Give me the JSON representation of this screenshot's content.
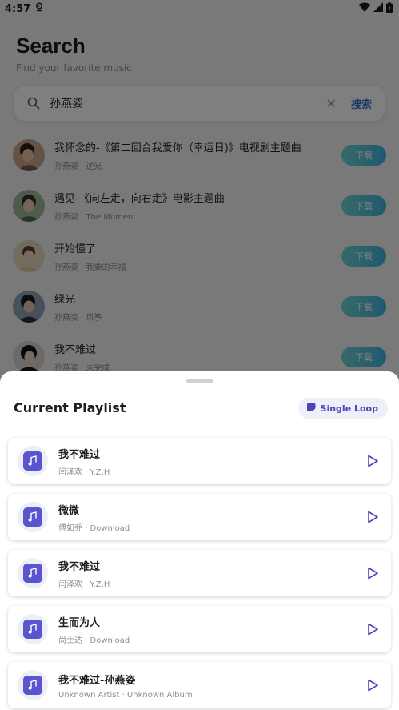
{
  "status": {
    "time": "4:57"
  },
  "page": {
    "title": "Search",
    "subtitle": "Find your favorite music"
  },
  "search": {
    "value": "孙燕姿",
    "search_label": "搜索"
  },
  "results": [
    {
      "title": "我怀念的-《第二回合我爱你（幸运日)》电视剧主题曲",
      "subtitle": "孙燕姿 · 逆光",
      "download_label": "下载"
    },
    {
      "title": "遇见-《向左走，向右走》电影主题曲",
      "subtitle": "孙燕姿 · The Moment",
      "download_label": "下载"
    },
    {
      "title": "开始懂了",
      "subtitle": "孙燕姿 · 我要的幸福",
      "download_label": "下载"
    },
    {
      "title": "绿光",
      "subtitle": "孙燕姿 · 风筝",
      "download_label": "下载"
    },
    {
      "title": "我不难过",
      "subtitle": "孙燕姿 · 未完成",
      "download_label": "下载"
    }
  ],
  "sheet": {
    "title": "Current Playlist",
    "loop_label": "Single Loop",
    "tracks": [
      {
        "title": "我不难过",
        "subtitle": "闫泽欢 · Y.Z.H"
      },
      {
        "title": "微微",
        "subtitle": "傅如乔 · Download"
      },
      {
        "title": "我不难过",
        "subtitle": "闫泽欢 · Y.Z.H"
      },
      {
        "title": "生而为人",
        "subtitle": "尚士达 · Download"
      },
      {
        "title": "我不难过-孙燕姿",
        "subtitle": "Unknown Artist · Unknown Album"
      }
    ]
  },
  "colors": {
    "accent": "#5a55cf",
    "search_button": "#2f6fd6",
    "download_gradient_start": "#6fd3d3",
    "download_gradient_end": "#3fb4de"
  }
}
